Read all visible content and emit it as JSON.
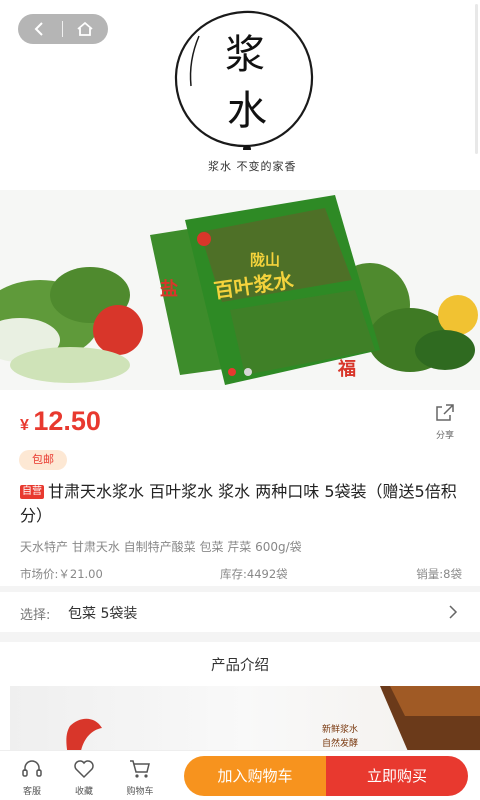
{
  "nav": {
    "back_icon": "back-arrow-icon",
    "home_icon": "home-icon"
  },
  "brand": {
    "logo_text_top": "浆",
    "logo_text_bottom": "水",
    "slogan": "浆水   不变的家香"
  },
  "photo": {
    "bag_brand": "陇山",
    "bag_title": "百叶浆水",
    "bag_char_left": "盐",
    "bag_char_right": "福",
    "carousel_count": 2,
    "carousel_active": 0
  },
  "product": {
    "currency": "¥",
    "price": "12.50",
    "share_label": "分享",
    "free_shipping": "包邮",
    "self_tag": "自营",
    "title": "甘肃天水浆水 百叶浆水 浆水 两种口味 5袋装（赠送5倍积分）",
    "subtitle": "天水特产 甘肃天水 自制特产酸菜 包菜 芹菜 600g/袋",
    "market_price": "市场价:￥21.00",
    "stock": "库存:4492袋",
    "sales": "销量:8袋"
  },
  "selection": {
    "label": "选择:",
    "value": "包菜 5袋装"
  },
  "intro": {
    "heading": "产品介绍",
    "tagline1": "新鲜浆水",
    "tagline2": "自然发酵"
  },
  "bottom_bar": {
    "service": "客服",
    "favorite": "收藏",
    "cart": "购物车",
    "add_to_cart": "加入购物车",
    "buy_now": "立即购买"
  },
  "colors": {
    "accent_red": "#e8392f",
    "accent_orange": "#f7931e",
    "badge_bg": "#fde8d4"
  }
}
